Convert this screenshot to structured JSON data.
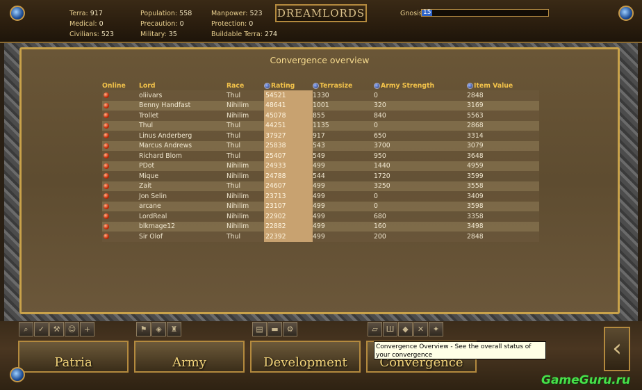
{
  "header": {
    "stats": {
      "terra": {
        "label": "Terra:",
        "value": "917"
      },
      "medical": {
        "label": "Medical:",
        "value": "0"
      },
      "civilians": {
        "label": "Civilians:",
        "value": "523"
      },
      "population": {
        "label": "Population:",
        "value": "558"
      },
      "precaution": {
        "label": "Precaution:",
        "value": "0"
      },
      "military": {
        "label": "Military:",
        "value": "35"
      },
      "manpower": {
        "label": "Manpower:",
        "value": "523"
      },
      "protection": {
        "label": "Protection:",
        "value": "0"
      },
      "buildable_terra": {
        "label": "Buildable Terra:",
        "value": "274"
      }
    },
    "logo": "DREAMLORDS",
    "gnosis": {
      "label": "Gnosis",
      "value": "15",
      "fraction": 0.08
    }
  },
  "panel": {
    "title": "Convergence overview",
    "columns": [
      "Online",
      "Lord",
      "Race",
      "Rating",
      "Terrasize",
      "Army Strength",
      "Item Value"
    ],
    "rows": [
      {
        "lord": "oliivars",
        "race": "Thul",
        "rating": "54521",
        "terrasize": "1330",
        "army": "0",
        "item": "2848"
      },
      {
        "lord": "Benny Handfast",
        "race": "Nihilim",
        "rating": "48641",
        "terrasize": "1001",
        "army": "320",
        "item": "3169"
      },
      {
        "lord": "Trollet",
        "race": "Nihilim",
        "rating": "45078",
        "terrasize": "855",
        "army": "840",
        "item": "5563"
      },
      {
        "lord": "Thul",
        "race": "Thul",
        "rating": "44251",
        "terrasize": "1135",
        "army": "0",
        "item": "2868"
      },
      {
        "lord": "Linus Anderberg",
        "race": "Thul",
        "rating": "37927",
        "terrasize": "917",
        "army": "650",
        "item": "3314"
      },
      {
        "lord": "Marcus Andrews",
        "race": "Thul",
        "rating": "25838",
        "terrasize": "543",
        "army": "3700",
        "item": "3079"
      },
      {
        "lord": "Richard Blom",
        "race": "Thul",
        "rating": "25407",
        "terrasize": "549",
        "army": "950",
        "item": "3648"
      },
      {
        "lord": "PDot",
        "race": "Nihilim",
        "rating": "24933",
        "terrasize": "499",
        "army": "1440",
        "item": "4959"
      },
      {
        "lord": "Mique",
        "race": "Nihilim",
        "rating": "24788",
        "terrasize": "544",
        "army": "1720",
        "item": "3599"
      },
      {
        "lord": "Zait",
        "race": "Thul",
        "rating": "24607",
        "terrasize": "499",
        "army": "3250",
        "item": "3558"
      },
      {
        "lord": "Jon Selin",
        "race": "Nihilim",
        "rating": "23713",
        "terrasize": "499",
        "army": "0",
        "item": "3409"
      },
      {
        "lord": "arcane",
        "race": "Nihilim",
        "rating": "23107",
        "terrasize": "499",
        "army": "0",
        "item": "3598"
      },
      {
        "lord": "LordReal",
        "race": "Nihilim",
        "rating": "22902",
        "terrasize": "499",
        "army": "680",
        "item": "3358"
      },
      {
        "lord": "blkmage12",
        "race": "Nihilim",
        "rating": "22882",
        "terrasize": "499",
        "army": "160",
        "item": "3498"
      },
      {
        "lord": "Sir Olof",
        "race": "Thul",
        "rating": "22392",
        "terrasize": "499",
        "army": "200",
        "item": "2848"
      }
    ]
  },
  "nav": {
    "patria": "Patria",
    "army": "Army",
    "development": "Development",
    "convergence": "Convergence"
  },
  "tooltip": "Convergence Overview - See the overall status of your convergence",
  "watermark": "GameGuru.ru",
  "colors": {
    "accent_gold": "#f2c24a",
    "panel_brown": "#5e4c30",
    "online_orb": "#c8320e"
  }
}
